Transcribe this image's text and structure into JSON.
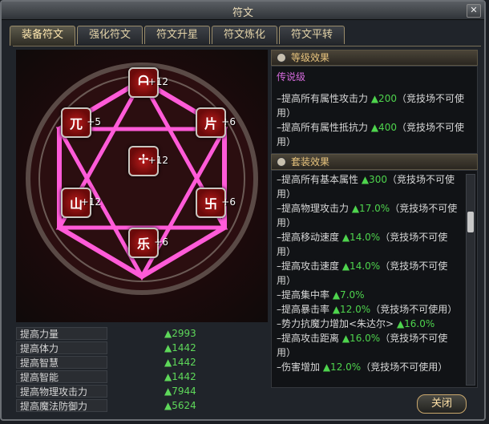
{
  "window": {
    "title": "符文",
    "close_glyph": "✕"
  },
  "tabs": [
    "装备符文",
    "强化符文",
    "符文升星",
    "符文炼化",
    "符文平转"
  ],
  "runes": [
    {
      "glyph": "ᗩ",
      "level": "+12"
    },
    {
      "glyph": "兀",
      "level": "+5"
    },
    {
      "glyph": "片",
      "level": "+6"
    },
    {
      "glyph": "✢",
      "level": "+12"
    },
    {
      "glyph": "山",
      "level": "+12"
    },
    {
      "glyph": "卐",
      "level": "+6"
    },
    {
      "glyph": "乐",
      "level": "+6"
    }
  ],
  "stats": [
    {
      "name": "提高力量",
      "value": "▲2993"
    },
    {
      "name": "提高体力",
      "value": "▲1442"
    },
    {
      "name": "提高智慧",
      "value": "▲1442"
    },
    {
      "name": "提高智能",
      "value": "▲1442"
    },
    {
      "name": "提高物理攻击力",
      "value": "▲7944"
    },
    {
      "name": "提高魔法防御力",
      "value": "▲5624"
    }
  ],
  "level_effect": {
    "header": "等级效果",
    "grade": "传说级",
    "lines": [
      {
        "text": "–提高所有属性攻击力 ",
        "up": "▲200",
        "tail": "（竞技场不可使用）"
      },
      {
        "text": "–提高所有属性抵抗力 ",
        "up": "▲400",
        "tail": "（竞技场不可使用）"
      }
    ]
  },
  "set_effect": {
    "header": "套装效果",
    "lines": [
      {
        "text": "–提高所有基本属性 ",
        "up": "▲300",
        "tail": "（竞技场不可使用）"
      },
      {
        "text": "–提高物理攻击力 ",
        "up": "▲17.0%",
        "tail": "（竞技场不可使用）"
      },
      {
        "text": "–提高移动速度 ",
        "up": "▲14.0%",
        "tail": "（竞技场不可使用）"
      },
      {
        "text": "–提高攻击速度 ",
        "up": "▲14.0%",
        "tail": "（竞技场不可使用）"
      },
      {
        "text": "–提高集中率 ",
        "up": "▲7.0%",
        "tail": ""
      },
      {
        "text": "–提高暴击率 ",
        "up": "▲12.0%",
        "tail": "（竞技场不可使用）"
      },
      {
        "text": "–势力抗魔力增加<朱达尔> ",
        "up": "▲16.0%",
        "tail": ""
      },
      {
        "text": "–提高攻击距离 ",
        "up": "▲16.0%",
        "tail": "（竞技场不可使用）"
      },
      {
        "text": "–伤害增加 ",
        "up": "▲12.0%",
        "tail": "（竞技场不可使用）"
      }
    ]
  },
  "close_button": "关闭",
  "colors": {
    "accent_gold": "#e9c57e",
    "up_green": "#4ed44d",
    "legend_purple": "#d66bdd"
  }
}
